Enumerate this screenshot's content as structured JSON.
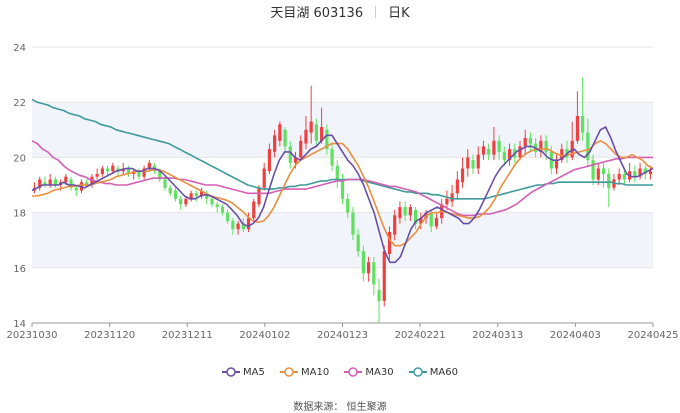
{
  "header": {
    "stock_name": "天目湖 603136",
    "period": "日K"
  },
  "source_text": "数据来源： 恒生聚源",
  "colors": {
    "up": "#ef4040",
    "down": "#5fe05f",
    "ma5": "#6a4fa8",
    "ma10": "#e8903e",
    "ma30": "#d35fb4",
    "ma60": "#3f9a9a",
    "band": "#f2f4fb",
    "grid": "#e6e6e6"
  },
  "chart_data": {
    "type": "candlestick",
    "ylim": [
      14,
      24
    ],
    "yticks": [
      14,
      16,
      18,
      20,
      22,
      24
    ],
    "x_tick_labels": [
      "20231030",
      "20231120",
      "20231211",
      "20240102",
      "20240123",
      "20240221",
      "20240313",
      "20240403",
      "20240425"
    ],
    "series": [
      {
        "name": "MA5",
        "values": [
          18.8,
          18.9,
          19.0,
          19.0,
          19.0,
          19.0,
          19.1,
          19.0,
          19.0,
          18.95,
          18.9,
          19.0,
          19.1,
          19.2,
          19.3,
          19.4,
          19.5,
          19.55,
          19.6,
          19.6,
          19.5,
          19.5,
          19.6,
          19.6,
          19.55,
          19.4,
          19.2,
          19.0,
          18.8,
          18.6,
          18.5,
          18.5,
          18.6,
          18.65,
          18.6,
          18.5,
          18.4,
          18.3,
          18.1,
          17.9,
          17.6,
          17.5,
          17.6,
          17.8,
          18.2,
          18.8,
          19.4,
          19.9,
          20.2,
          20.2,
          20.0,
          19.9,
          20.1,
          20.3,
          20.4,
          20.6,
          20.8,
          20.8,
          20.5,
          20.2,
          19.9,
          19.7,
          19.4,
          19.0,
          18.5,
          18.0,
          17.3,
          16.6,
          16.2,
          16.2,
          16.4,
          16.9,
          17.4,
          17.7,
          17.8,
          18.0,
          18.1,
          18.2,
          18.1,
          18.0,
          17.9,
          17.8,
          17.6,
          17.6,
          17.8,
          18.1,
          18.5,
          18.9,
          19.3,
          19.6,
          19.8,
          20.0,
          20.2,
          20.3,
          20.4,
          20.4,
          20.3,
          20.2,
          20.0,
          19.9,
          19.9,
          20.0,
          20.2,
          20.3,
          20.1,
          20.0,
          20.2,
          20.6,
          21.0,
          21.1,
          20.7,
          20.2,
          19.8,
          19.4,
          19.3,
          19.3,
          19.4,
          19.5,
          19.6
        ]
      },
      {
        "name": "MA10",
        "values": [
          18.6,
          18.6,
          18.65,
          18.7,
          18.8,
          18.85,
          18.9,
          18.95,
          18.95,
          19.0,
          19.0,
          19.0,
          19.05,
          19.1,
          19.15,
          19.2,
          19.3,
          19.35,
          19.4,
          19.45,
          19.5,
          19.5,
          19.5,
          19.55,
          19.55,
          19.5,
          19.4,
          19.3,
          19.2,
          19.1,
          19.0,
          18.9,
          18.8,
          18.7,
          18.6,
          18.55,
          18.5,
          18.45,
          18.35,
          18.2,
          18.05,
          17.85,
          17.7,
          17.65,
          17.7,
          17.9,
          18.2,
          18.6,
          19.0,
          19.4,
          19.7,
          19.9,
          20.0,
          20.1,
          20.2,
          20.3,
          20.4,
          20.5,
          20.5,
          20.5,
          20.3,
          20.0,
          19.7,
          19.3,
          18.9,
          18.4,
          17.9,
          17.4,
          17.0,
          16.8,
          16.8,
          16.9,
          17.1,
          17.3,
          17.6,
          17.9,
          18.0,
          18.0,
          18.05,
          18.0,
          17.95,
          17.9,
          17.85,
          17.8,
          17.8,
          17.85,
          18.0,
          18.2,
          18.5,
          18.9,
          19.2,
          19.5,
          19.8,
          20.0,
          20.15,
          20.25,
          20.3,
          20.3,
          20.3,
          20.2,
          20.1,
          20.05,
          20.1,
          20.15,
          20.2,
          20.25,
          20.3,
          20.5,
          20.6,
          20.5,
          20.3,
          20.1,
          20.0,
          20.0,
          20.1,
          20.0,
          19.9,
          19.7,
          19.6
        ]
      },
      {
        "name": "MA30",
        "values": [
          20.6,
          20.5,
          20.3,
          20.2,
          20.0,
          19.9,
          19.7,
          19.55,
          19.45,
          19.35,
          19.3,
          19.2,
          19.15,
          19.1,
          19.05,
          19.05,
          19.0,
          19.0,
          19.0,
          19.05,
          19.1,
          19.15,
          19.2,
          19.25,
          19.25,
          19.25,
          19.25,
          19.25,
          19.2,
          19.2,
          19.15,
          19.1,
          19.05,
          19.0,
          19.0,
          19.0,
          18.95,
          18.9,
          18.85,
          18.8,
          18.75,
          18.7,
          18.7,
          18.7,
          18.7,
          18.7,
          18.75,
          18.8,
          18.85,
          18.85,
          18.85,
          18.85,
          18.85,
          18.9,
          18.95,
          19.0,
          19.05,
          19.1,
          19.15,
          19.15,
          19.2,
          19.2,
          19.2,
          19.2,
          19.15,
          19.1,
          19.05,
          19.0,
          18.95,
          18.95,
          18.9,
          18.85,
          18.8,
          18.75,
          18.65,
          18.55,
          18.45,
          18.35,
          18.25,
          18.15,
          18.05,
          17.95,
          17.9,
          17.9,
          17.9,
          17.95,
          17.95,
          17.95,
          18.0,
          18.05,
          18.1,
          18.2,
          18.3,
          18.45,
          18.6,
          18.75,
          18.85,
          18.95,
          19.05,
          19.15,
          19.25,
          19.35,
          19.45,
          19.55,
          19.6,
          19.65,
          19.7,
          19.75,
          19.8,
          19.85,
          19.9,
          19.95,
          19.95,
          20.0,
          20.0,
          20.0,
          20.0,
          20.0,
          20.0
        ]
      },
      {
        "name": "MA60",
        "values": [
          22.1,
          22.0,
          21.95,
          21.9,
          21.8,
          21.75,
          21.7,
          21.6,
          21.55,
          21.5,
          21.4,
          21.35,
          21.3,
          21.2,
          21.15,
          21.1,
          21.0,
          20.95,
          20.9,
          20.85,
          20.8,
          20.75,
          20.7,
          20.65,
          20.6,
          20.55,
          20.5,
          20.4,
          20.3,
          20.2,
          20.1,
          20.0,
          19.9,
          19.8,
          19.7,
          19.6,
          19.5,
          19.4,
          19.3,
          19.2,
          19.1,
          19.0,
          18.95,
          18.9,
          18.85,
          18.85,
          18.85,
          18.9,
          18.9,
          18.95,
          18.95,
          19.0,
          19.0,
          19.05,
          19.1,
          19.15,
          19.15,
          19.2,
          19.2,
          19.2,
          19.2,
          19.2,
          19.2,
          19.15,
          19.1,
          19.05,
          19.0,
          18.95,
          18.9,
          18.85,
          18.8,
          18.75,
          18.75,
          18.7,
          18.7,
          18.7,
          18.65,
          18.65,
          18.6,
          18.55,
          18.5,
          18.5,
          18.5,
          18.5,
          18.5,
          18.5,
          18.5,
          18.55,
          18.6,
          18.65,
          18.7,
          18.75,
          18.8,
          18.85,
          18.9,
          18.95,
          19.0,
          19.0,
          19.05,
          19.05,
          19.1,
          19.1,
          19.1,
          19.1,
          19.1,
          19.1,
          19.1,
          19.1,
          19.1,
          19.1,
          19.1,
          19.05,
          19.05,
          19.0,
          19.0,
          19.0,
          19.0,
          19.0,
          19.0
        ]
      }
    ],
    "candles": [
      [
        18.8,
        18.9,
        18.7,
        19.1
      ],
      [
        18.9,
        19.2,
        18.8,
        19.3
      ],
      [
        19.1,
        19.0,
        18.9,
        19.3
      ],
      [
        19.0,
        19.2,
        18.9,
        19.4
      ],
      [
        19.2,
        19.0,
        18.9,
        19.3
      ],
      [
        19.0,
        19.1,
        18.8,
        19.2
      ],
      [
        19.1,
        19.3,
        19.0,
        19.4
      ],
      [
        19.2,
        18.9,
        18.8,
        19.3
      ],
      [
        18.9,
        18.8,
        18.6,
        19.0
      ],
      [
        18.8,
        19.1,
        18.7,
        19.2
      ],
      [
        19.1,
        19.0,
        18.9,
        19.2
      ],
      [
        19.0,
        19.3,
        18.9,
        19.4
      ],
      [
        19.3,
        19.4,
        19.2,
        19.6
      ],
      [
        19.4,
        19.6,
        19.3,
        19.7
      ],
      [
        19.6,
        19.5,
        19.3,
        19.7
      ],
      [
        19.5,
        19.7,
        19.4,
        19.8
      ],
      [
        19.6,
        19.5,
        19.3,
        19.7
      ],
      [
        19.5,
        19.6,
        19.4,
        19.8
      ],
      [
        19.6,
        19.4,
        19.3,
        19.7
      ],
      [
        19.4,
        19.5,
        19.2,
        19.6
      ],
      [
        19.5,
        19.3,
        19.2,
        19.6
      ],
      [
        19.3,
        19.6,
        19.2,
        19.7
      ],
      [
        19.6,
        19.8,
        19.5,
        19.9
      ],
      [
        19.7,
        19.5,
        19.4,
        19.8
      ],
      [
        19.5,
        19.2,
        19.1,
        19.6
      ],
      [
        19.2,
        18.9,
        18.8,
        19.3
      ],
      [
        18.9,
        18.7,
        18.6,
        19.0
      ],
      [
        18.8,
        18.5,
        18.4,
        18.9
      ],
      [
        18.5,
        18.3,
        18.1,
        18.6
      ],
      [
        18.3,
        18.5,
        18.2,
        18.6
      ],
      [
        18.5,
        18.7,
        18.4,
        18.8
      ],
      [
        18.7,
        18.6,
        18.4,
        18.8
      ],
      [
        18.6,
        18.8,
        18.5,
        18.9
      ],
      [
        18.7,
        18.5,
        18.3,
        18.8
      ],
      [
        18.5,
        18.3,
        18.2,
        18.6
      ],
      [
        18.3,
        18.2,
        18.0,
        18.4
      ],
      [
        18.2,
        18.0,
        17.9,
        18.3
      ],
      [
        18.0,
        17.7,
        17.6,
        18.1
      ],
      [
        17.7,
        17.4,
        17.2,
        17.8
      ],
      [
        17.4,
        17.6,
        17.2,
        17.7
      ],
      [
        17.6,
        17.4,
        17.3,
        17.8
      ],
      [
        17.4,
        17.8,
        17.3,
        18.0
      ],
      [
        17.8,
        18.4,
        17.7,
        18.5
      ],
      [
        18.3,
        18.9,
        18.2,
        19.0
      ],
      [
        18.9,
        19.6,
        18.8,
        19.8
      ],
      [
        19.5,
        20.3,
        19.4,
        20.5
      ],
      [
        20.2,
        20.8,
        20.0,
        21.0
      ],
      [
        20.6,
        21.2,
        20.4,
        21.3
      ],
      [
        21.0,
        20.4,
        20.2,
        21.1
      ],
      [
        20.4,
        19.8,
        19.6,
        20.6
      ],
      [
        19.8,
        20.0,
        19.6,
        20.2
      ],
      [
        20.0,
        20.6,
        19.9,
        20.8
      ],
      [
        20.5,
        21.0,
        20.3,
        21.5
      ],
      [
        20.9,
        21.3,
        20.5,
        22.6
      ],
      [
        21.2,
        20.6,
        20.4,
        21.4
      ],
      [
        20.6,
        21.1,
        20.5,
        21.8
      ],
      [
        21.0,
        20.3,
        20.1,
        21.2
      ],
      [
        20.3,
        19.7,
        19.5,
        20.5
      ],
      [
        19.7,
        19.2,
        18.9,
        19.9
      ],
      [
        19.2,
        18.5,
        18.3,
        19.4
      ],
      [
        18.5,
        18.0,
        17.8,
        18.7
      ],
      [
        18.0,
        17.2,
        17.0,
        18.2
      ],
      [
        17.2,
        16.6,
        16.4,
        17.4
      ],
      [
        16.6,
        15.8,
        15.5,
        16.8
      ],
      [
        15.8,
        16.2,
        15.5,
        16.4
      ],
      [
        16.2,
        15.4,
        15.0,
        16.4
      ],
      [
        15.2,
        14.8,
        14.0,
        15.6
      ],
      [
        14.8,
        16.6,
        14.6,
        16.8
      ],
      [
        16.5,
        17.3,
        16.3,
        17.5
      ],
      [
        17.2,
        17.9,
        17.0,
        18.1
      ],
      [
        17.8,
        18.2,
        17.6,
        18.4
      ],
      [
        18.2,
        17.9,
        17.7,
        18.4
      ],
      [
        17.9,
        18.2,
        17.7,
        18.3
      ],
      [
        18.1,
        17.6,
        17.4,
        18.2
      ],
      [
        17.6,
        17.8,
        17.4,
        18.0
      ],
      [
        17.8,
        18.0,
        17.6,
        18.1
      ],
      [
        18.0,
        17.5,
        17.3,
        18.1
      ],
      [
        17.5,
        17.8,
        17.4,
        18.0
      ],
      [
        17.8,
        18.3,
        17.6,
        18.5
      ],
      [
        18.3,
        18.5,
        18.1,
        18.8
      ],
      [
        18.4,
        18.7,
        18.2,
        19.0
      ],
      [
        18.7,
        19.2,
        18.5,
        19.5
      ],
      [
        19.1,
        19.6,
        18.9,
        20.0
      ],
      [
        19.6,
        20.0,
        19.3,
        20.3
      ],
      [
        19.9,
        19.6,
        19.4,
        20.1
      ],
      [
        19.6,
        20.1,
        19.4,
        20.4
      ],
      [
        20.1,
        20.4,
        19.9,
        20.6
      ],
      [
        20.3,
        20.1,
        19.9,
        20.5
      ],
      [
        20.1,
        20.6,
        19.9,
        21.1
      ],
      [
        20.6,
        20.2,
        19.9,
        20.8
      ],
      [
        20.2,
        19.9,
        19.7,
        20.4
      ],
      [
        19.9,
        20.3,
        19.7,
        20.5
      ],
      [
        20.3,
        20.0,
        19.8,
        20.5
      ],
      [
        20.0,
        20.4,
        19.9,
        20.6
      ],
      [
        20.4,
        20.7,
        20.1,
        21.0
      ],
      [
        20.7,
        20.5,
        20.2,
        20.9
      ],
      [
        20.5,
        20.2,
        20.0,
        20.7
      ],
      [
        20.2,
        20.6,
        20.0,
        20.8
      ],
      [
        20.6,
        20.2,
        19.9,
        20.8
      ],
      [
        20.2,
        19.6,
        19.4,
        20.4
      ],
      [
        19.6,
        19.9,
        19.4,
        20.1
      ],
      [
        19.9,
        20.3,
        19.8,
        20.5
      ],
      [
        20.3,
        20.0,
        19.8,
        20.6
      ],
      [
        20.0,
        20.6,
        19.9,
        21.3
      ],
      [
        20.6,
        21.5,
        20.5,
        22.4
      ],
      [
        21.5,
        20.9,
        20.6,
        22.9
      ],
      [
        20.9,
        19.9,
        19.7,
        21.4
      ],
      [
        19.9,
        19.2,
        19.0,
        20.1
      ],
      [
        19.2,
        19.6,
        19.0,
        19.8
      ],
      [
        19.6,
        19.4,
        18.9,
        19.8
      ],
      [
        19.4,
        18.9,
        18.2,
        19.6
      ],
      [
        18.9,
        19.2,
        18.8,
        19.4
      ],
      [
        19.2,
        19.4,
        19.0,
        19.6
      ],
      [
        19.4,
        19.2,
        19.0,
        19.6
      ],
      [
        19.2,
        19.5,
        19.1,
        19.8
      ],
      [
        19.5,
        19.3,
        19.1,
        19.7
      ],
      [
        19.3,
        19.6,
        19.2,
        19.8
      ],
      [
        19.6,
        19.4,
        19.2,
        19.7
      ],
      [
        19.4,
        19.5,
        19.2,
        19.7
      ]
    ]
  }
}
